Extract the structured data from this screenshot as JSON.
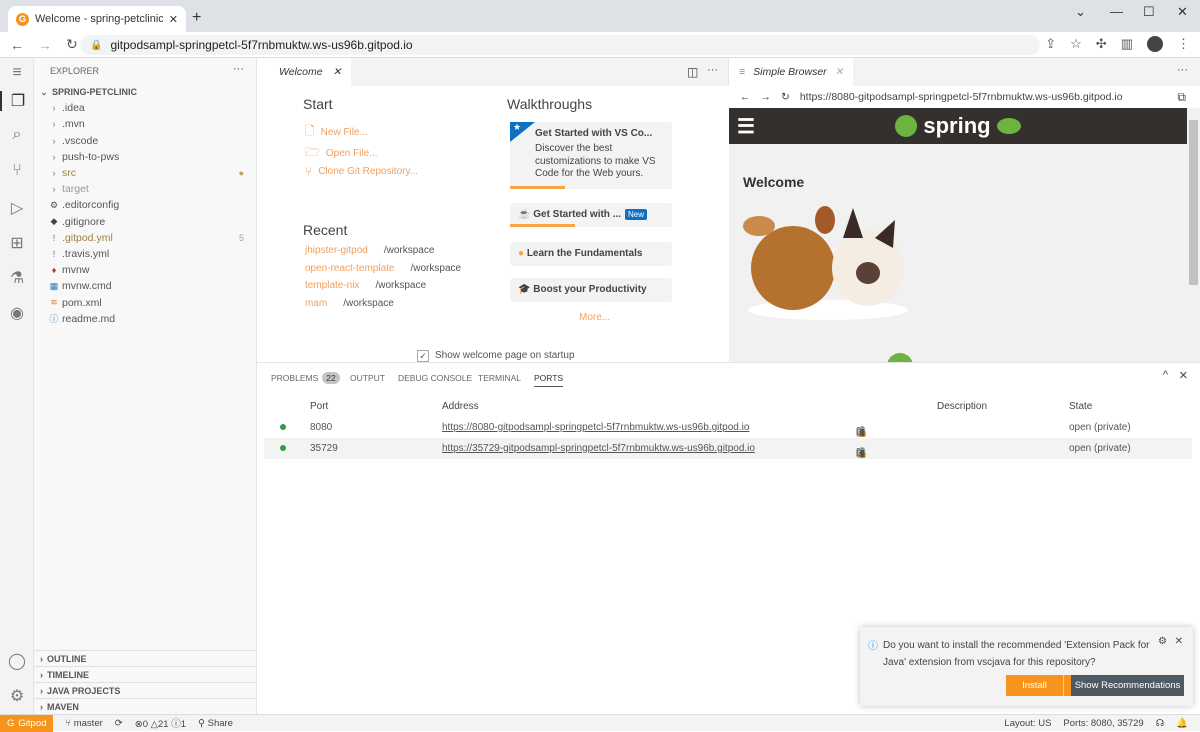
{
  "browser": {
    "tab_title": "Welcome - spring-petclinic - Gitpod",
    "url": "gitpodsampl-springpetcl-5f7rnbmuktw.ws-us96b.gitpod.io"
  },
  "activity": [
    "menu-icon",
    "explorer-icon",
    "search-icon",
    "source-control-icon",
    "run-debug-icon",
    "extensions-icon",
    "testing-icon",
    "github-icon",
    "account-icon",
    "settings-icon"
  ],
  "explorer": {
    "header": "EXPLORER",
    "root": "SPRING-PETCLINIC",
    "items": [
      {
        "name": ".idea",
        "type": "folder"
      },
      {
        "name": ".mvn",
        "type": "folder"
      },
      {
        "name": ".vscode",
        "type": "folder"
      },
      {
        "name": "push-to-pws",
        "type": "folder"
      },
      {
        "name": "src",
        "type": "folder",
        "decoration": "●"
      },
      {
        "name": "target",
        "type": "folder"
      },
      {
        "name": ".editorconfig",
        "type": "file"
      },
      {
        "name": ".gitignore",
        "type": "file"
      },
      {
        "name": ".gitpod.yml",
        "type": "file",
        "decoration": "5"
      },
      {
        "name": ".travis.yml",
        "type": "file"
      },
      {
        "name": "mvnw",
        "type": "file"
      },
      {
        "name": "mvnw.cmd",
        "type": "file"
      },
      {
        "name": "pom.xml",
        "type": "file"
      },
      {
        "name": "readme.md",
        "type": "file"
      }
    ],
    "sections": [
      "OUTLINE",
      "TIMELINE",
      "JAVA PROJECTS",
      "MAVEN"
    ]
  },
  "welcome": {
    "tab": "Welcome",
    "start_title": "Start",
    "start": [
      "New File...",
      "Open File...",
      "Clone Git Repository..."
    ],
    "recent_title": "Recent",
    "recent": [
      {
        "name": "jhipster-gitpod",
        "path": "/workspace"
      },
      {
        "name": "open-react-template",
        "path": "/workspace"
      },
      {
        "name": "template-nix",
        "path": "/workspace"
      },
      {
        "name": "mam",
        "path": "/workspace"
      }
    ],
    "walk_title": "Walkthroughs",
    "walk1_title": "Get Started with VS Co...",
    "walk1_desc": "Discover the best customizations to make VS Code for the Web yours.",
    "walk2": "Get Started with ...",
    "new_badge": "New",
    "walk3": "Learn the Fundamentals",
    "walk4": "Boost your Productivity",
    "more": "More...",
    "show_on_startup": "Show welcome page on startup",
    "accent": "#f7a443"
  },
  "simple_browser": {
    "tab": "Simple Browser",
    "url": "https://8080-gitpodsampl-springpetcl-5f7rnbmuktw.ws-us96b.gitpod.io",
    "brand": "spring",
    "heading": "Welcome"
  },
  "panel": {
    "tabs": [
      {
        "label": "PROBLEMS",
        "badge": "22"
      },
      {
        "label": "OUTPUT"
      },
      {
        "label": "DEBUG CONSOLE"
      },
      {
        "label": "TERMINAL"
      },
      {
        "label": "PORTS",
        "active": true
      }
    ],
    "columns": [
      "Port",
      "Address",
      "Description",
      "State"
    ],
    "rows": [
      {
        "port": "8080",
        "address": "https://8080-gitpodsampl-springpetcl-5f7rnbmuktw.ws-us96b.gitpod.io",
        "state": "open (private)"
      },
      {
        "port": "35729",
        "address": "https://35729-gitpodsampl-springpetcl-5f7rnbmuktw.ws-us96b.gitpod.io",
        "state": "open (private)"
      }
    ]
  },
  "notification": {
    "message": "Do you want to install the recommended 'Extension Pack for Java' extension from vscjava for this repository?",
    "install": "Install",
    "show": "Show Recommendations"
  },
  "status": {
    "gitpod": "Gitpod",
    "branch": "master",
    "errors": "0",
    "warnings": "21",
    "info": "1",
    "share": "Share",
    "layout": "Layout: US",
    "ports": "Ports: 8080, 35729",
    "brand_color": "#f7941d"
  }
}
